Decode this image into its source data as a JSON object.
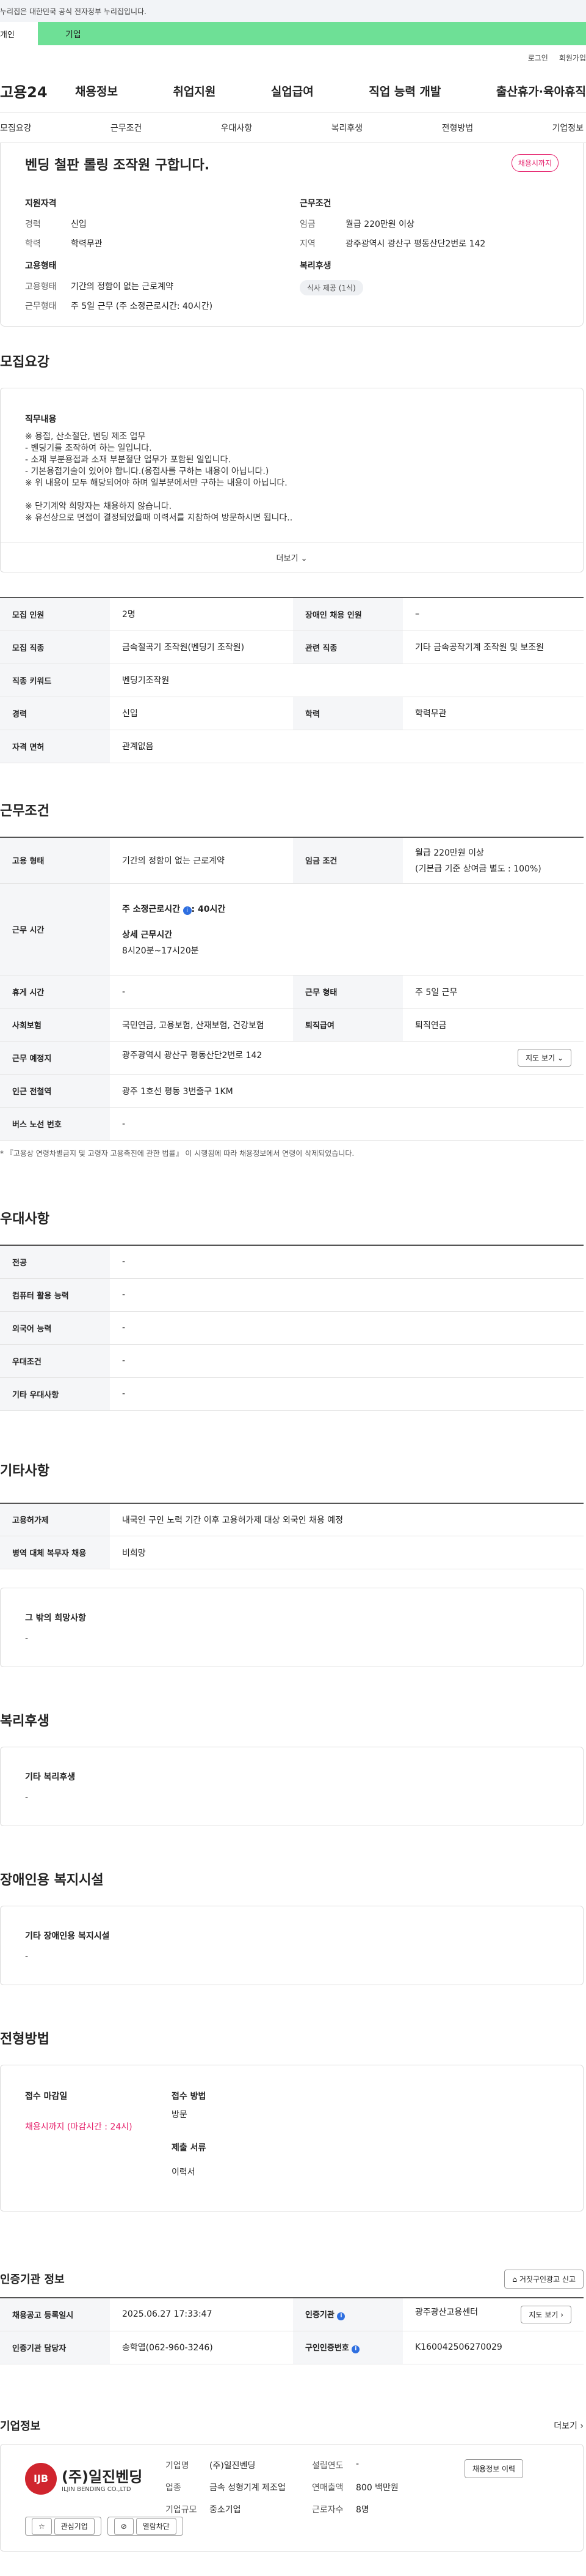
{
  "topbar": {
    "text": "누리집은 대한민국 공식 전자정부 누리집입니다."
  },
  "tabs": {
    "t1": "개인",
    "t2": "기업"
  },
  "util": {
    "login": "로그인",
    "join": "회원가입"
  },
  "gnb": {
    "logo": "고용24",
    "menu": [
      "채용정보",
      "취업지원",
      "실업급여",
      "직업 능력 개발",
      "출산휴가·육아휴직"
    ]
  },
  "subnav": [
    "모집요강",
    "근무조건",
    "우대사항",
    "복리후생",
    "전형방법",
    "기업정보"
  ],
  "summary": {
    "title": "벤딩 철판 롤링 조작원 구합니다.",
    "dday": "채용시까지",
    "qualify": {
      "title": "지원자격",
      "items": [
        {
          "k": "경력",
          "v": "신입"
        },
        {
          "k": "학력",
          "v": "학력무관"
        }
      ]
    },
    "employ": {
      "title": "고용형태",
      "items": [
        {
          "k": "고용형태",
          "v": "기간의 정함이 없는 근로계약"
        },
        {
          "k": "근무형태",
          "v": "주 5일 근무 (주 소정근로시간: 40시간)"
        }
      ]
    },
    "cond": {
      "title": "근무조건",
      "items": [
        {
          "k": "임금",
          "v": "월급 220만원 이상"
        },
        {
          "k": "지역",
          "v": "광주광역시 광산구 평동산단2번로 142"
        }
      ]
    },
    "welfare": {
      "title": "복리후생",
      "badge": "식사 제공 (1식)"
    }
  },
  "recruit": {
    "title": "모집요강",
    "desc_title": "직무내용",
    "lines": [
      "※ 용접, 산소절단, 벤딩 제조 업무",
      " - 벤딩기를 조작하여 하는 일입니다.",
      " - 소재 부분용접과 소재 부분절단 업무가 포함된 일입니다.",
      " - 기본용접기술이 있어야 합니다.(용접사를 구하는 내용이 아닙니다.)",
      "※ 위 내용이 모두 해당되어야 하며 일부분에서만 구하는 내용이 아닙니다.",
      "",
      "※ 단기계약 희망자는 채용하지 않습니다.",
      "※ 유선상으로 면접이 결정되었을때 이력서를 지참하여 방문하시면 됩니다.."
    ],
    "more": "더보기",
    "rows": [
      [
        {
          "h": "모집 인원"
        },
        {
          "v": "2명"
        },
        {
          "h": "장애인 채용 인원"
        },
        {
          "v": "–"
        }
      ],
      [
        {
          "h": "모집 직종"
        },
        {
          "v": "금속절곡기 조작원(벤딩기 조작원)"
        },
        {
          "h": "관련 직종"
        },
        {
          "v": "기타 금속공작기계 조작원 및 보조원"
        }
      ],
      [
        {
          "h": "직종 키워드"
        },
        {
          "v": "벤딩기조작원"
        }
      ],
      [
        {
          "h": "경력"
        },
        {
          "v": "신입"
        },
        {
          "h": "학력"
        },
        {
          "v": "학력무관"
        }
      ],
      [
        {
          "h": "자격 면허"
        },
        {
          "v": "관계없음"
        }
      ]
    ]
  },
  "work": {
    "title": "근무조건",
    "employ_h": "고용 형태",
    "employ_v": "기간의 정함이 없는 근로계약",
    "wage_h": "임금 조건",
    "wage_v1": "월급 220만원 이상",
    "wage_v2": "(기본급 기준 상여금 별도 : 100%)",
    "time_h": "근무 시간",
    "time_a": "주 소정근로시간",
    "time_a2": ": 40시간",
    "time_b": "상세 근무시간",
    "time_b2": "8시20분~17시20분",
    "rest_h": "휴게 시간",
    "rest_v": "-",
    "form_h": "근무 형태",
    "form_v": "주 5일 근무",
    "ins_h": "사회보험",
    "ins_v": "국민연금, 고용보험, 산재보험, 건강보험",
    "ret_h": "퇴직급여",
    "ret_v": "퇴직연금",
    "place_h": "근무 예정지",
    "place_v": "광주광역시 광산구 평동산단2번로 142",
    "map": "지도 보기",
    "station_h": "인근 전철역",
    "station_v": "광주 1호선 평동 3번출구 1KM",
    "bus_h": "버스 노선 번호",
    "bus_v": "-",
    "note": "* 『고용상 연령차별금지 및 고령자 고용촉진에 관한 법률』 이 시행됨에 따라 채용정보에서 연령이 삭제되었습니다."
  },
  "prefer": {
    "title": "우대사항",
    "rows": [
      {
        "h": "전공",
        "v": "-"
      },
      {
        "h": "컴퓨터 활용 능력",
        "v": "-"
      },
      {
        "h": "외국어 능력",
        "v": "-"
      },
      {
        "h": "우대조건",
        "v": "-"
      },
      {
        "h": "기타 우대사항",
        "v": "-"
      }
    ]
  },
  "etc": {
    "title": "기타사항",
    "rows": [
      {
        "h": "고용허가제",
        "v": "내국인 구인 노력 기간 이후 고용허가제 대상 외국인 채용 예정"
      },
      {
        "h": "병역 대체 복무자 채용",
        "v": "비희망"
      }
    ],
    "box_title": "그 밖의 희망사항",
    "box_v": "-"
  },
  "welfare": {
    "title": "복리후생",
    "box_title": "기타 복리후생",
    "box_v": "-"
  },
  "disabled": {
    "title": "장애인용 복지시설",
    "box_title": "기타 장애인용 복지시설",
    "box_v": "-"
  },
  "apply": {
    "title": "전형방법",
    "deadline_t": "접수 마감일",
    "deadline_v": "채용시까지 (마감시간 : 24시)",
    "method_t": "접수 방법",
    "method_v": "방문",
    "doc_t": "제출 서류",
    "doc_v": "이력서"
  },
  "agency": {
    "title": "인증기관 정보",
    "report": "거짓구인광고 신고",
    "rows": [
      {
        "h1": "채용공고 등록일시",
        "v1": "2025.06.27 17:33:47",
        "h2": "인증기관",
        "v2": "광주광산고용센터",
        "btn": "지도 보기"
      },
      {
        "h1": "인증기관 담당자",
        "v1": "송학엽(062-960-3246)",
        "h2": "구인인증번호",
        "v2": "K160042506270029"
      }
    ]
  },
  "company": {
    "title": "기업정보",
    "more": "더보기",
    "logo_mark": "IJB",
    "name_ko": "(주)일진벤딩",
    "name_en": "ILJIN BENDING CO.,LTD",
    "interest": "관심기업",
    "block": "열람차단",
    "col1": [
      {
        "k": "기업명",
        "v": "(주)일진벤딩"
      },
      {
        "k": "업종",
        "v": "금속 성형기계 제조업"
      },
      {
        "k": "기업규모",
        "v": "중소기업"
      }
    ],
    "col2": [
      {
        "k": "설립연도",
        "v": "-"
      },
      {
        "k": "연매출액",
        "v": "800 백만원"
      },
      {
        "k": "근로자수",
        "v": "8명"
      }
    ],
    "history": "채용정보 이력"
  }
}
